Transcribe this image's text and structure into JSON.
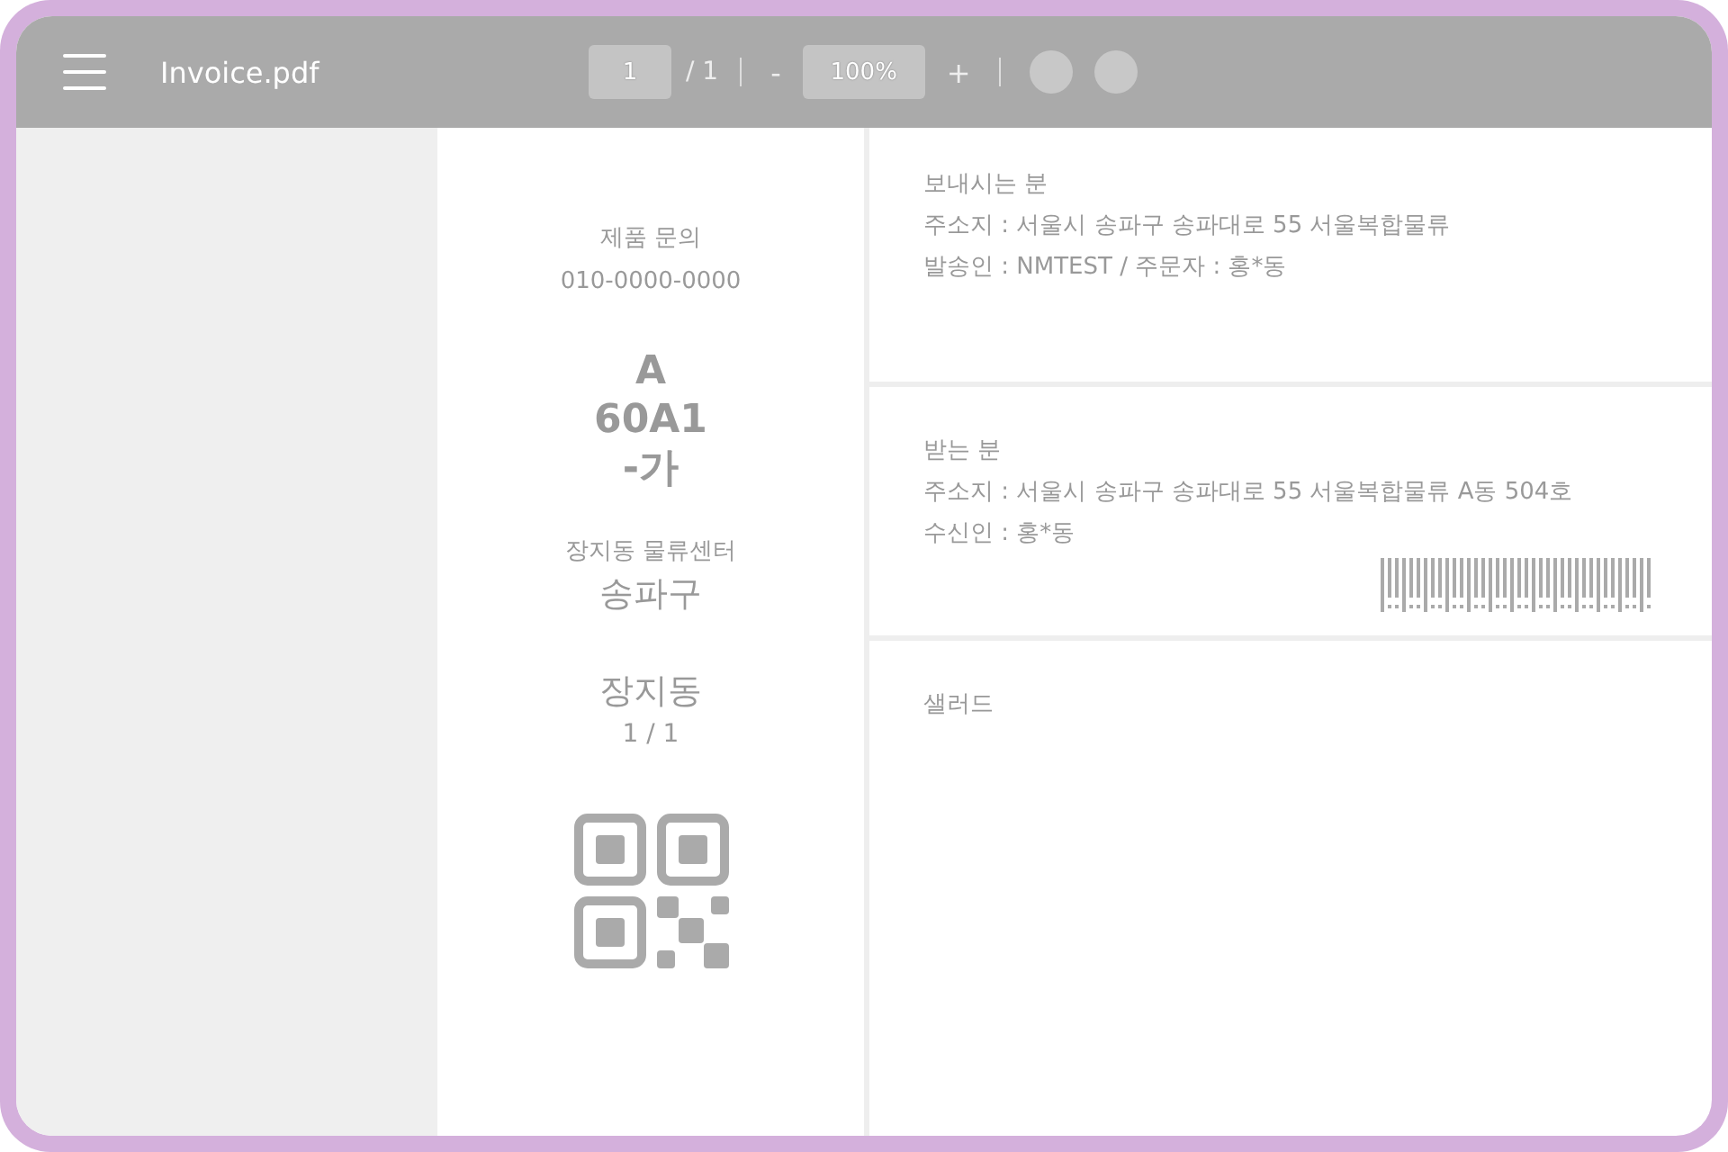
{
  "toolbar": {
    "title": "Invoice.pdf",
    "page_input": "1",
    "page_total": "/ 1",
    "zoom_out": "-",
    "zoom_value": "100%",
    "zoom_in": "+"
  },
  "label": {
    "inquiry_title": "제품 문의",
    "inquiry_phone": "010-0000-0000",
    "sort_code": [
      "A",
      "60A1",
      "-가"
    ],
    "center": "장지동 물류센터",
    "district": "송파구",
    "area": "장지동",
    "count": "1 / 1"
  },
  "sender": {
    "heading": "보내시는 분",
    "lines": [
      "주소지 : 서울시 송파구 송파대로 55 서울복합물류",
      "발송인 : NMTEST / 주문자 : 홍*동"
    ]
  },
  "receiver": {
    "heading": "받는 분",
    "lines": [
      "주소지 : 서울시 송파구 송파대로 55 서울복합물류 A동 504호",
      "수신인 : 홍*동"
    ]
  },
  "item": {
    "name": "샐러드"
  }
}
